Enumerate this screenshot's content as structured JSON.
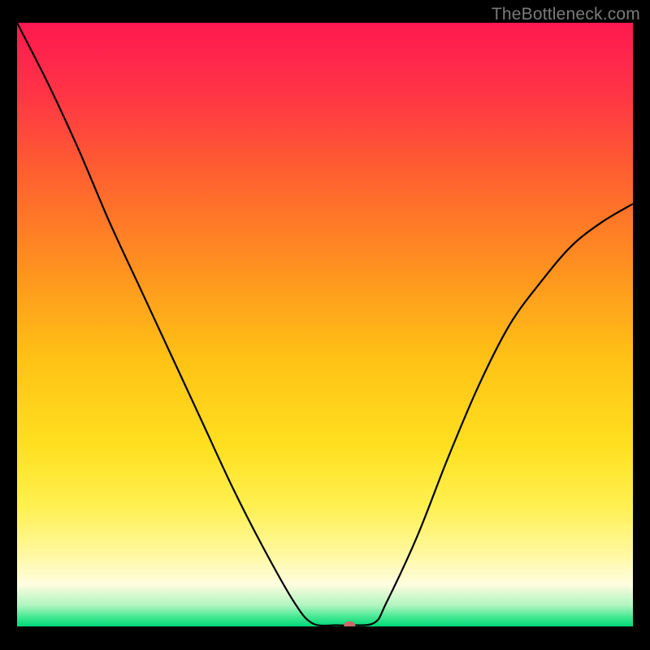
{
  "watermark": "TheBottleneck.com",
  "chart_data": {
    "type": "line",
    "title": "",
    "xlabel": "",
    "ylabel": "",
    "xlim": [
      0,
      100
    ],
    "ylim": [
      0,
      100
    ],
    "legend": false,
    "grid": false,
    "background_gradient": {
      "stops": [
        {
          "offset": 0.0,
          "color": "#ff1850"
        },
        {
          "offset": 0.12,
          "color": "#ff3545"
        },
        {
          "offset": 0.25,
          "color": "#ff6030"
        },
        {
          "offset": 0.4,
          "color": "#ff8f20"
        },
        {
          "offset": 0.55,
          "color": "#ffc015"
        },
        {
          "offset": 0.7,
          "color": "#ffe020"
        },
        {
          "offset": 0.8,
          "color": "#fff050"
        },
        {
          "offset": 0.88,
          "color": "#fff8a0"
        },
        {
          "offset": 0.93,
          "color": "#fffde0"
        },
        {
          "offset": 0.965,
          "color": "#b0f5c0"
        },
        {
          "offset": 0.985,
          "color": "#40e890"
        },
        {
          "offset": 1.0,
          "color": "#00d878"
        }
      ]
    },
    "series": [
      {
        "name": "bottleneck-curve",
        "color": "#000000",
        "x": [
          0,
          5,
          10,
          15,
          20,
          25,
          30,
          35,
          40,
          45,
          48,
          52,
          54,
          58,
          60,
          65,
          70,
          75,
          80,
          85,
          90,
          95,
          100
        ],
        "y": [
          100,
          90,
          79,
          67,
          56,
          45,
          34,
          23,
          13,
          4,
          0.5,
          0.2,
          0.2,
          0.6,
          4,
          15,
          28,
          40,
          50,
          57,
          63,
          67,
          70
        ]
      }
    ],
    "marker": {
      "name": "optimal-point",
      "x": 54,
      "y": 0.2,
      "color": "#c76a6a",
      "rx": 7,
      "ry": 5
    }
  }
}
